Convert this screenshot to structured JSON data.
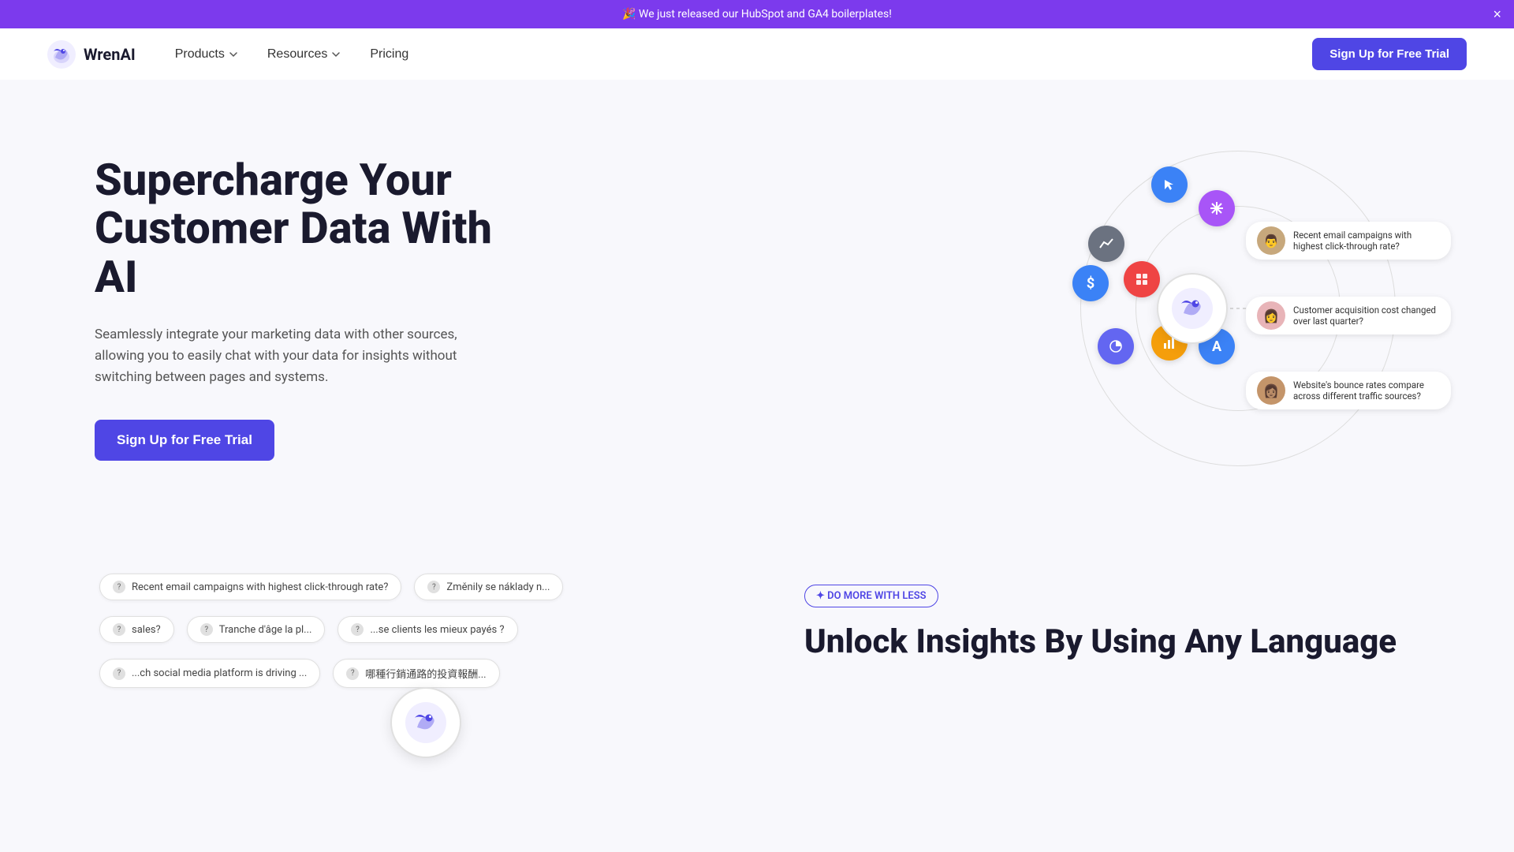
{
  "announcement": {
    "text": "🎉 We just released our HubSpot and GA4 boilerplates!",
    "close_label": "×"
  },
  "navbar": {
    "logo_text": "WrenAI",
    "nav_items": [
      {
        "label": "Products",
        "has_dropdown": true
      },
      {
        "label": "Resources",
        "has_dropdown": true
      },
      {
        "label": "Pricing",
        "has_dropdown": false
      }
    ],
    "cta_label": "Sign Up for Free Trial"
  },
  "hero": {
    "title": "Supercharge Your Customer Data With AI",
    "subtitle": "Seamlessly integrate your marketing data with other sources, allowing you to easily chat with your data for insights without switching between pages and systems.",
    "cta_label": "Sign Up for Free Trial",
    "queries": [
      {
        "text": "Recent email campaigns with highest click-through rate?",
        "avatar": "👨"
      },
      {
        "text": "Customer acquisition cost changed over last quarter?",
        "avatar": "👩"
      },
      {
        "text": "Website's bounce rates compare across different traffic sources?",
        "avatar": "👩🏽"
      }
    ]
  },
  "bottom": {
    "chips": [
      "Recent email campaigns with highest click-through rate?",
      "Změnily se náklady n...",
      "sales?",
      "Tranche d'âge la pl...",
      "...se clients les mieux payés ?",
      "...ch social media platform is driving ...",
      "哪種行銷通路的投資報酬..."
    ],
    "section_tag": "✦ DO MORE WITH LESS",
    "section_title": "Unlock Insights By Using Any Language"
  },
  "colors": {
    "purple": "#7c3aed",
    "indigo": "#4f46e5",
    "dark": "#1a1a2e"
  }
}
